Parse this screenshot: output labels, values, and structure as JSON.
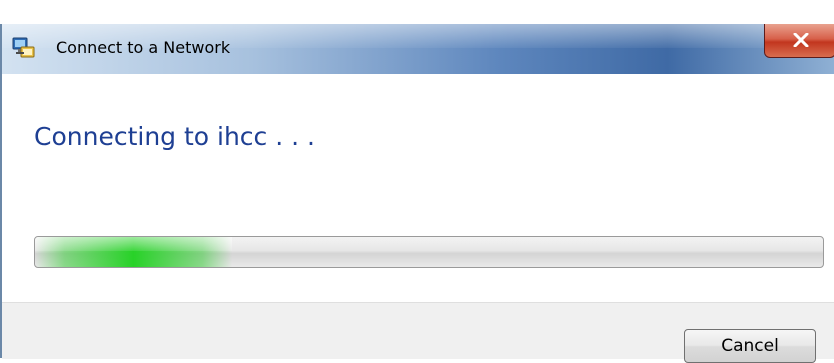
{
  "window": {
    "title": "Connect to a Network"
  },
  "icons": {
    "app": "network-connect-icon",
    "close": "close-icon"
  },
  "main": {
    "heading": "Connecting to ihcc . . ."
  },
  "progress": {
    "mode": "indeterminate",
    "highlight_start": 0,
    "highlight_end": 0.25
  },
  "footer": {
    "cancel_label": "Cancel"
  },
  "colors": {
    "heading": "#1e3f93",
    "progress_accent": "#2fd22f",
    "close_button": "#c2361f"
  }
}
